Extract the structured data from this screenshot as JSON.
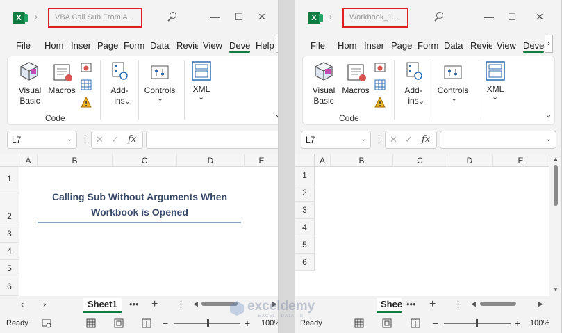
{
  "left": {
    "title": "VBA Call Sub From A...",
    "tabs": [
      "File",
      "Hom",
      "Inser",
      "Page",
      "Form",
      "Data",
      "Revie",
      "View",
      "Deve",
      "Help"
    ],
    "ribbon": {
      "visual_basic": "Visual Basic",
      "macros": "Macros",
      "code_group": "Code",
      "addins": "Add-ins",
      "controls": "Controls",
      "xml": "XML"
    },
    "name_box": "L7",
    "columns": [
      "A",
      "B",
      "C",
      "D",
      "E"
    ],
    "rows": [
      "1",
      "2",
      "3",
      "4",
      "5",
      "6"
    ],
    "heading": "Calling Sub Without Arguments When Workbook is Opened",
    "sheet_tab": "Sheet1",
    "status": "Ready",
    "zoom": "100%"
  },
  "right": {
    "title": "Workbook_1...",
    "tabs": [
      "File",
      "Hom",
      "Inser",
      "Page",
      "Form",
      "Data",
      "Revie",
      "View",
      "Deve"
    ],
    "ribbon": {
      "visual_basic": "Visual Basic",
      "macros": "Macros",
      "code_group": "Code",
      "addins": "Add-ins",
      "controls": "Controls",
      "xml": "XML"
    },
    "name_box": "L7",
    "columns": [
      "A",
      "B",
      "C",
      "D",
      "E"
    ],
    "rows": [
      "1",
      "2",
      "3",
      "4",
      "5",
      "6"
    ],
    "sheet_tab": "Shee",
    "status": "Ready",
    "zoom": "100%"
  },
  "watermark": {
    "brand": "exceldemy",
    "tagline": "EXCEL · DATA · BI"
  },
  "colors": {
    "excel_green": "#107c41",
    "title_highlight": "#e02020",
    "heading_text": "#3a4a6b",
    "heading_rule": "#8aa0c0"
  }
}
